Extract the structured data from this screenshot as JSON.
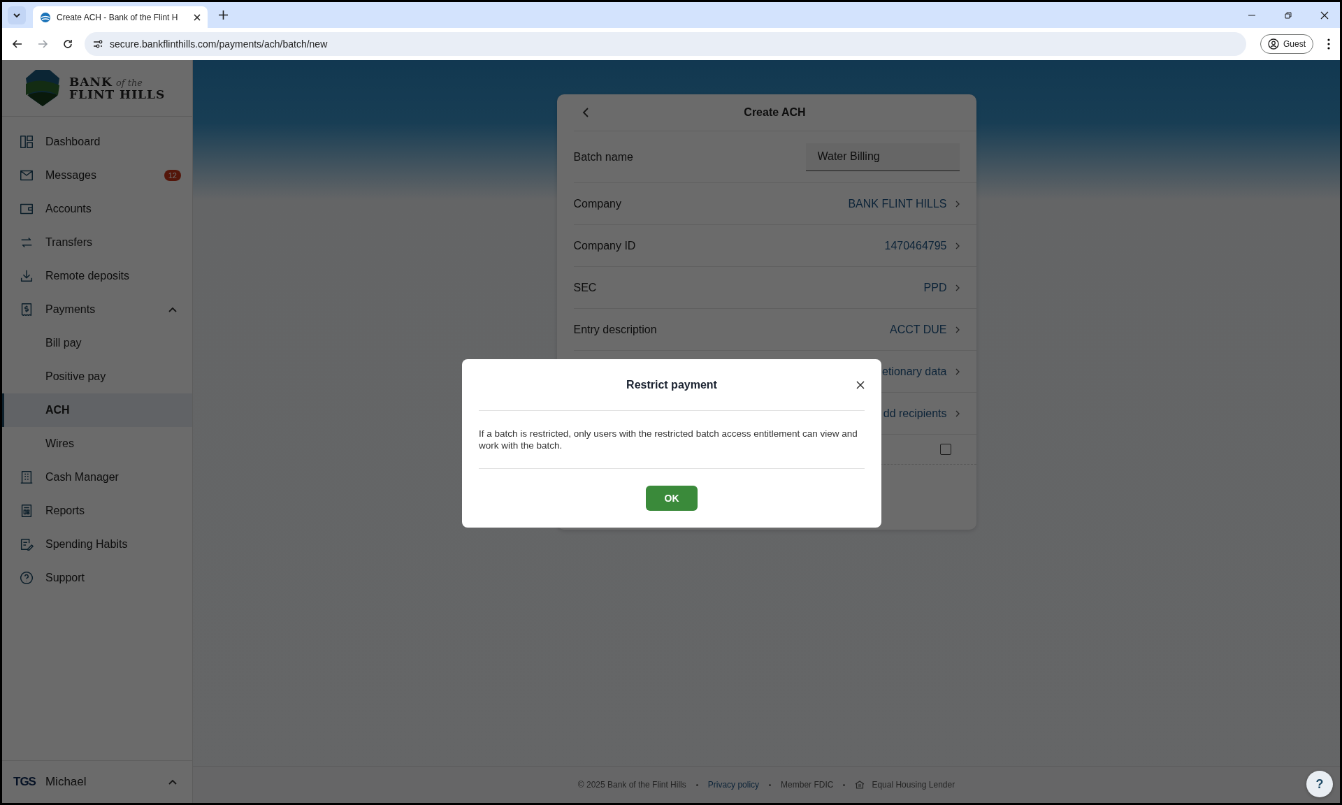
{
  "browser": {
    "tab_title": "Create ACH - Bank of the Flint H",
    "url": "secure.bankflinthills.com/payments/ach/batch/new",
    "profile": "Guest"
  },
  "sidebar": {
    "logo": {
      "word1": "BANK",
      "small": "of the",
      "word2": "FLINT HILLS"
    },
    "items": [
      {
        "label": "Dashboard",
        "selected": false
      },
      {
        "label": "Messages",
        "selected": false,
        "badge": "12"
      },
      {
        "label": "Accounts",
        "selected": false
      },
      {
        "label": "Transfers",
        "selected": false
      },
      {
        "label": "Remote deposits",
        "selected": false
      },
      {
        "label": "Payments",
        "selected": false,
        "expanded": true,
        "children": [
          {
            "label": "Bill pay",
            "selected": false
          },
          {
            "label": "Positive pay",
            "selected": false
          },
          {
            "label": "ACH",
            "selected": true
          },
          {
            "label": "Wires",
            "selected": false
          }
        ]
      },
      {
        "label": "Cash Manager",
        "selected": false
      },
      {
        "label": "Reports",
        "selected": false
      },
      {
        "label": "Spending Habits",
        "selected": false
      },
      {
        "label": "Support",
        "selected": false
      }
    ],
    "user": {
      "initials": "TGS",
      "name": "Michael"
    }
  },
  "card": {
    "title": "Create ACH",
    "batch_name": {
      "label": "Batch name",
      "value": "Water Billing"
    },
    "rows": [
      {
        "kind": "link",
        "label": "Company",
        "value": "BANK FLINT HILLS"
      },
      {
        "kind": "link",
        "label": "Company ID",
        "value": "1470464795"
      },
      {
        "kind": "link",
        "label": "SEC",
        "value": "PPD"
      },
      {
        "kind": "link",
        "label": "Entry description",
        "value": "ACCT DUE"
      },
      {
        "kind": "link",
        "value": "etionary data"
      },
      {
        "kind": "link",
        "value": "dd recipients"
      },
      {
        "kind": "checkbox",
        "checked": false
      }
    ]
  },
  "dialog": {
    "title": "Restrict payment",
    "message": "If a batch is restricted, only users with the restricted batch access entitlement can view and work with the batch.",
    "button": "OK"
  },
  "footer": {
    "copyright": "© 2025 Bank of the Flint Hills",
    "privacy": "Privacy policy",
    "member": "Member FDIC",
    "housing": "Equal Housing Lender"
  },
  "help_button": "?"
}
